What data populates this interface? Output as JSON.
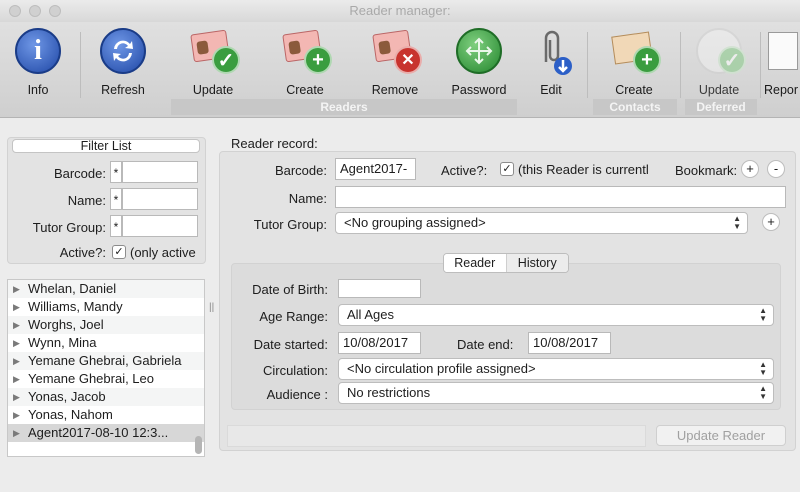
{
  "window": {
    "title": "Reader manager:"
  },
  "toolbar": {
    "info": "Info",
    "refresh": "Refresh",
    "update": "Update",
    "create": "Create",
    "remove": "Remove",
    "password": "Password",
    "edit": "Edit",
    "contacts_create": "Create",
    "deferred_update": "Update",
    "report": "Repor",
    "group_readers": "Readers",
    "group_contacts": "Contacts",
    "group_deferred": "Deferred"
  },
  "filter": {
    "title": "Filter List",
    "barcode_label": "Barcode:",
    "barcode_prefix": "*",
    "barcode_value": "",
    "name_label": "Name:",
    "name_prefix": "*",
    "name_value": "",
    "tutor_label": "Tutor Group:",
    "tutor_prefix": "*",
    "tutor_value": "",
    "active_label": "Active?:",
    "active_check": "✓",
    "active_text": "(only active"
  },
  "readers": [
    "Whelan,  Daniel",
    "Williams,  Mandy",
    "Worghs,  Joel",
    "Wynn,  Mina",
    "Yemane Ghebrai,  Gabriela",
    "Yemane Ghebrai,  Leo",
    "Yonas,  Jacob",
    "Yonas,  Nahom",
    "Agent2017-08-10 12:3..."
  ],
  "record": {
    "heading": "Reader record:",
    "barcode_label": "Barcode:",
    "barcode_value": "Agent2017-",
    "active_label": "Active?:",
    "active_check": "✓",
    "active_text": "(this Reader is currentl",
    "bookmark_label": "Bookmark:",
    "bookmark_add": "+",
    "bookmark_remove": "-",
    "name_label": "Name:",
    "name_value": "",
    "tutor_label": "Tutor Group:",
    "tutor_value": "<No grouping assigned>",
    "tutor_add": "+",
    "tab_reader": "Reader",
    "tab_history": "History",
    "dob_label": "Date of Birth:",
    "dob_value": "",
    "age_label": "Age Range:",
    "age_value": "All Ages",
    "started_label": "Date started:",
    "started_value": "10/08/2017",
    "end_label": "Date end:",
    "end_value": "10/08/2017",
    "circulation_label": "Circulation:",
    "circulation_value": "<No circulation profile assigned>",
    "audience_label": "Audience :",
    "audience_value": "No restrictions",
    "update_button": "Update Reader"
  },
  "arrows": {
    "up": "▲",
    "down": "▼",
    "tri": "▶",
    "split": "||"
  },
  "icons": [
    "info-icon",
    "refresh-icon",
    "reader-card-update-icon",
    "reader-card-create-icon",
    "reader-card-remove-icon",
    "password-icon",
    "edit-paperclip-icon",
    "contact-create-icon",
    "deferred-update-icon",
    "report-icon"
  ],
  "colors": {
    "blue": "#2b57b8",
    "green": "#2e9a3b",
    "red": "#c8332e",
    "toolbar": "#d8d8d8"
  }
}
